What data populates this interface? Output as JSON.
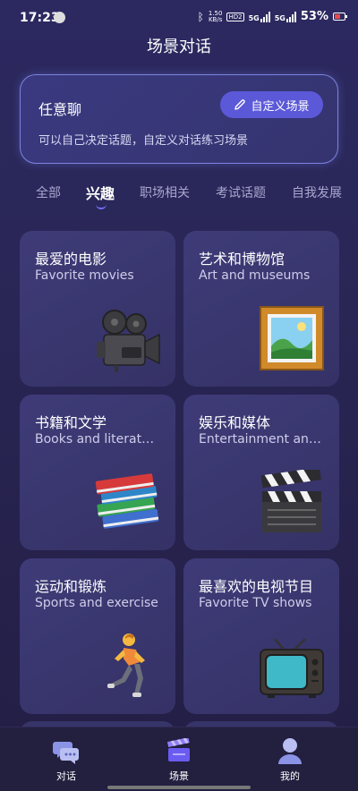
{
  "status_bar": {
    "time": "17:23",
    "net_speed_top": "1.50",
    "net_speed_bottom": "KB/s",
    "hd_label": "HD",
    "hd_sub": "2",
    "signal_1_label": "5G",
    "signal_2_label": "5G",
    "battery_percent": "53%"
  },
  "header": {
    "title": "场景对话"
  },
  "free_chat": {
    "title": "任意聊",
    "description": "可以自己决定话题，自定义对话练习场景",
    "custom_button_label": "自定义场景",
    "button_color": "#5b59d8"
  },
  "tabs": [
    {
      "label": "全部",
      "active": false
    },
    {
      "label": "兴趣",
      "active": true
    },
    {
      "label": "职场相关",
      "active": false
    },
    {
      "label": "考试话题",
      "active": false
    },
    {
      "label": "自我发展",
      "active": false
    }
  ],
  "scenes": [
    {
      "title_cn": "最爱的电影",
      "title_en": "Favorite movies",
      "icon": "movie-camera-icon"
    },
    {
      "title_cn": "艺术和博物馆",
      "title_en": "Art and museums",
      "icon": "framed-picture-icon"
    },
    {
      "title_cn": "书籍和文学",
      "title_en": "Books and literat…",
      "icon": "books-icon"
    },
    {
      "title_cn": "娱乐和媒体",
      "title_en": "Entertainment an…",
      "icon": "clapper-board-icon"
    },
    {
      "title_cn": "运动和锻炼",
      "title_en": "Sports and exercise",
      "icon": "running-person-icon"
    },
    {
      "title_cn": "最喜欢的电视节目",
      "title_en": "Favorite TV shows",
      "icon": "television-icon"
    }
  ],
  "bottom_nav": [
    {
      "label": "对话",
      "icon": "chat-bubbles-icon",
      "active": false
    },
    {
      "label": "场景",
      "icon": "scene-clapper-icon",
      "active": true
    },
    {
      "label": "我的",
      "icon": "user-profile-icon",
      "active": false
    }
  ],
  "colors": {
    "background": "#2a2758",
    "accent": "#6f6df0",
    "card": "#3a3772"
  }
}
